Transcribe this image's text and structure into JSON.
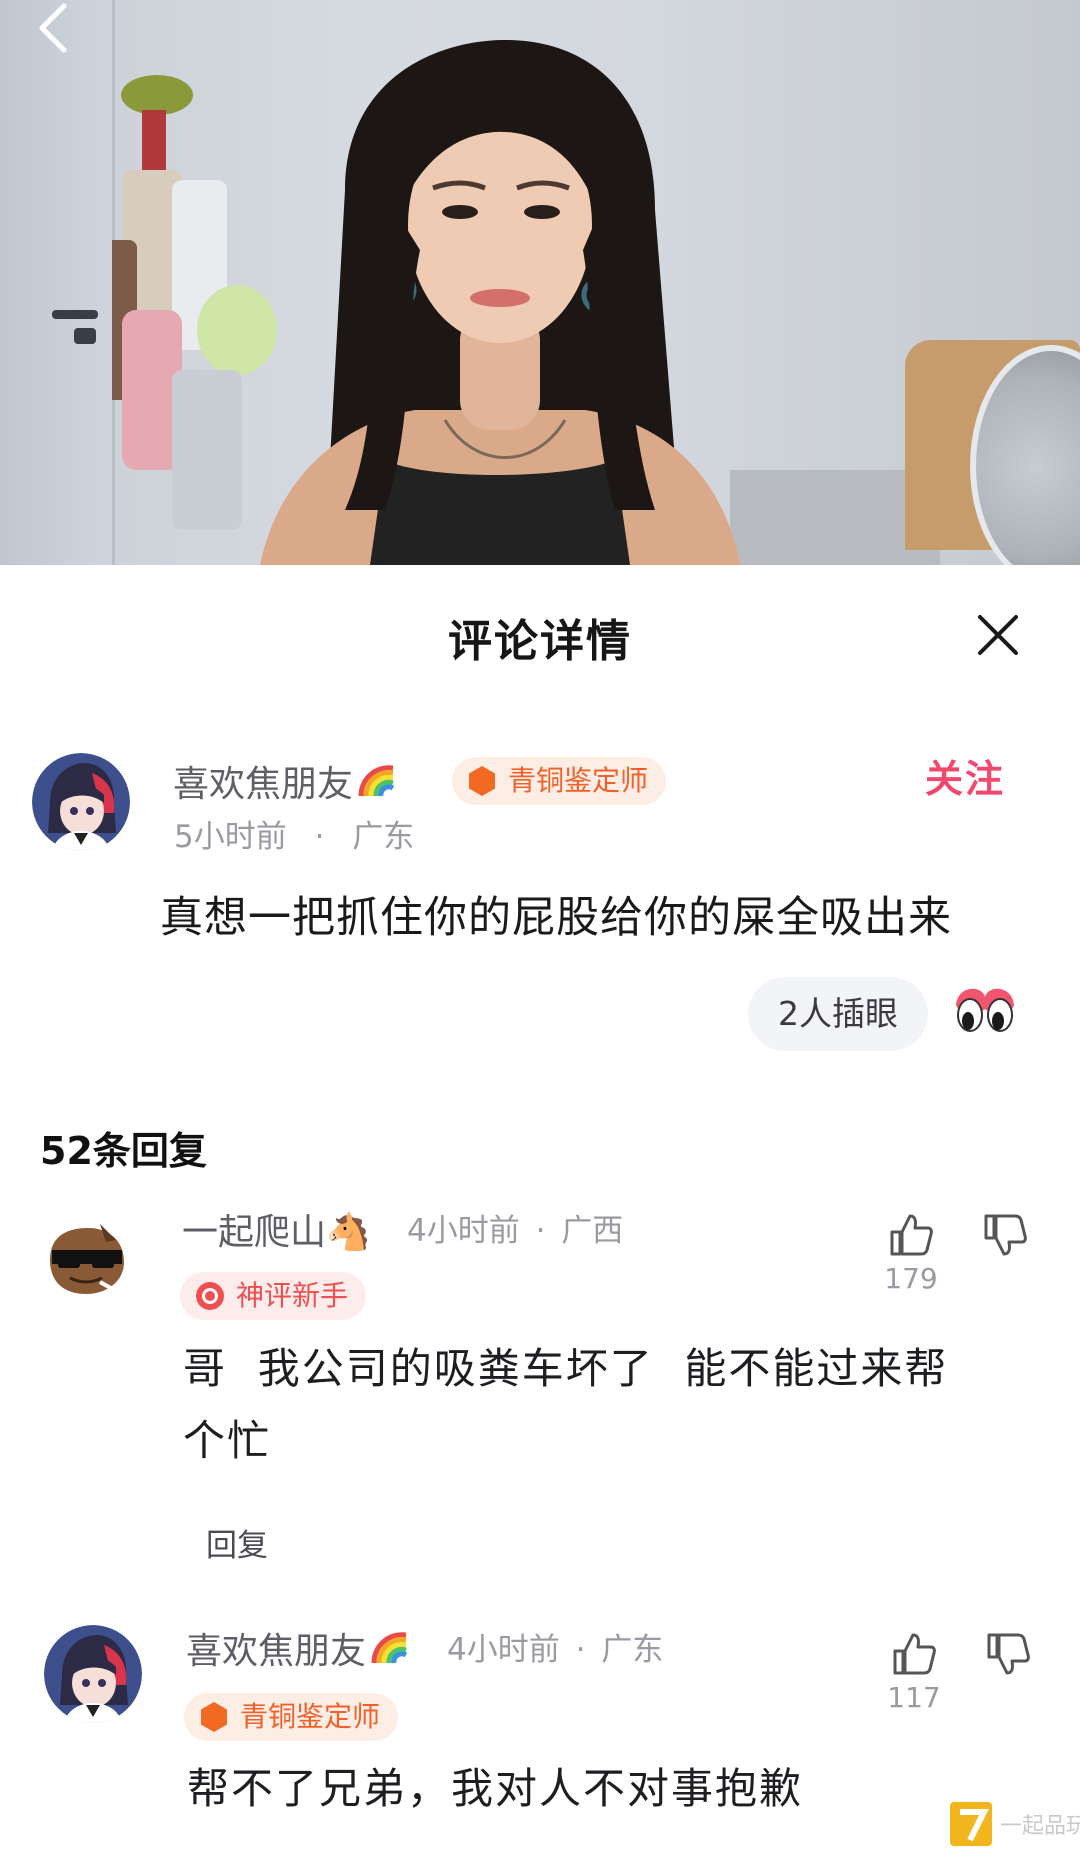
{
  "sheet": {
    "title": "评论详情"
  },
  "main_comment": {
    "author": "喜欢焦朋友",
    "badge": "青铜鉴定师",
    "time": "5小时前",
    "separator": "·",
    "location": "广东",
    "follow_label": "关注",
    "text": "真想一把抓住你的屁股给你的屎全吸出来",
    "reaction_label": "2人插眼"
  },
  "reply_count_label": "52条回复",
  "replies": [
    {
      "author": "一起爬山🐴",
      "time": "4小时前",
      "separator": "·",
      "location": "广西",
      "badge": "神评新手",
      "text_line1": "哥  我公司的吸粪车坏了  能不能过来帮",
      "text_line2": "个忙",
      "likes": "179",
      "reply_label": "回复"
    },
    {
      "author": "喜欢焦朋友",
      "time": "4小时前",
      "separator": "·",
      "location": "广东",
      "badge": "青铜鉴定师",
      "text_line1": "帮不了兄弟，我对人不对事抱歉",
      "likes": "117"
    }
  ],
  "watermark": "一起品玩",
  "colors": {
    "follow": "#f2486f",
    "badge_text": "#f2602a",
    "badge_bg": "#fdeee5",
    "reply_badge_icon": "#f04f4f"
  },
  "icons": [
    "back-icon",
    "close-icon",
    "rainbow-icon",
    "badge-hexagon-icon",
    "eyes-emoji-icon",
    "thumbs-up-icon",
    "thumbs-down-icon"
  ]
}
